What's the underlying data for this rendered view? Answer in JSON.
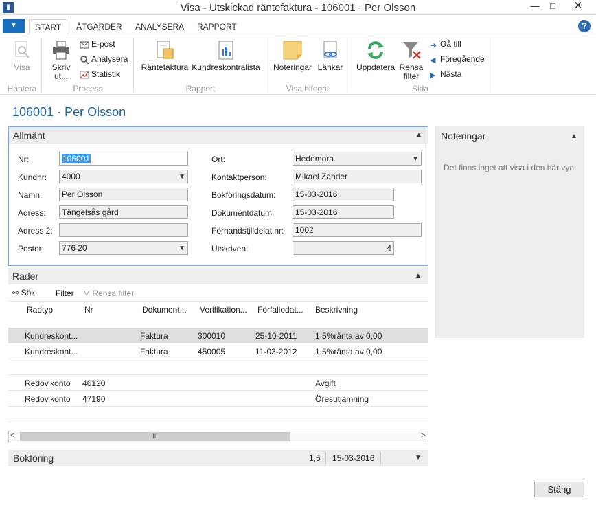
{
  "window": {
    "title": "Visa - Utskickad räntefaktura - 106001 · Per Olsson",
    "min": "—",
    "max": "□",
    "close": "✕"
  },
  "tabs": [
    "START",
    "ÅTGÄRDER",
    "ANALYSERA",
    "RAPPORT"
  ],
  "ribbon": {
    "visa": "Visa",
    "skriv_ut_1": "Skriv",
    "skriv_ut_2": "ut...",
    "epost": "E-post",
    "analysera": "Analysera",
    "statistik": "Statistik",
    "rantefaktura": "Räntefaktura",
    "kundreskontralista": "Kundreskontralista",
    "noteringar": "Noteringar",
    "lankar": "Länkar",
    "uppdatera": "Uppdatera",
    "rensa_1": "Rensa",
    "rensa_2": "filter",
    "ga_till": "Gå till",
    "foregaende": "Föregående",
    "nasta": "Nästa",
    "groups": {
      "hantera": "Hantera",
      "process": "Process",
      "rapport": "Rapport",
      "visa_bifogat": "Visa bifogat",
      "sida": "Sida"
    }
  },
  "page_title": "106001 · Per Olsson",
  "allmant": {
    "header": "Allmänt",
    "fields": {
      "nr_label": "Nr:",
      "nr_value": "106001",
      "kundnr_label": "Kundnr:",
      "kundnr_value": "4000",
      "namn_label": "Namn:",
      "namn_value": "Per Olsson",
      "adress_label": "Adress:",
      "adress_value": "Tängelsås gård",
      "adress2_label": "Adress 2:",
      "adress2_value": "",
      "postnr_label": "Postnr:",
      "postnr_value": "776 20",
      "ort_label": "Ort:",
      "ort_value": "Hedemora",
      "kontakt_label": "Kontaktperson:",
      "kontakt_value": "Mikael Zander",
      "bokf_label": "Bokföringsdatum:",
      "bokf_value": "15-03-2016",
      "dok_label": "Dokumentdatum:",
      "dok_value": "15-03-2016",
      "forh_label": "Förhandstilldelat nr:",
      "forh_value": "1002",
      "utskriven_label": "Utskriven:",
      "utskriven_value": "4"
    }
  },
  "rader": {
    "header": "Rader",
    "toolbar": {
      "sok": "Sök",
      "filter": "Filter",
      "rensa": "Rensa filter"
    },
    "columns": [
      "Radtyp",
      "Nr",
      "Dokument...",
      "Verifikation...",
      "Förfallodat...",
      "Beskrivning"
    ],
    "rows": [
      {
        "radtyp": "Kundreskont...",
        "nr": "",
        "dok": "Faktura",
        "ver": "300010",
        "forf": "25-10-2011",
        "beskr": "1,5%ränta av 0,00"
      },
      {
        "radtyp": "Kundreskont...",
        "nr": "",
        "dok": "Faktura",
        "ver": "450005",
        "forf": "11-03-2012",
        "beskr": "1,5%ränta av 0,00"
      },
      {
        "radtyp": "",
        "nr": "",
        "dok": "",
        "ver": "",
        "forf": "",
        "beskr": ""
      },
      {
        "radtyp": "Redov.konto",
        "nr": "46120",
        "dok": "",
        "ver": "",
        "forf": "",
        "beskr": "Avgift"
      },
      {
        "radtyp": "Redov.konto",
        "nr": "47190",
        "dok": "",
        "ver": "",
        "forf": "",
        "beskr": "Öresutjämning"
      },
      {
        "radtyp": "",
        "nr": "",
        "dok": "",
        "ver": "",
        "forf": "",
        "beskr": ""
      }
    ],
    "scroll_left": "<",
    "scroll_right": ">",
    "scroll_thumb": "III"
  },
  "bokforing": {
    "header": "Bokföring",
    "value1": "1,5",
    "value2": "15-03-2016"
  },
  "notes": {
    "header": "Noteringar",
    "empty": "Det finns inget att visa i den här vyn."
  },
  "stang": "Stäng"
}
